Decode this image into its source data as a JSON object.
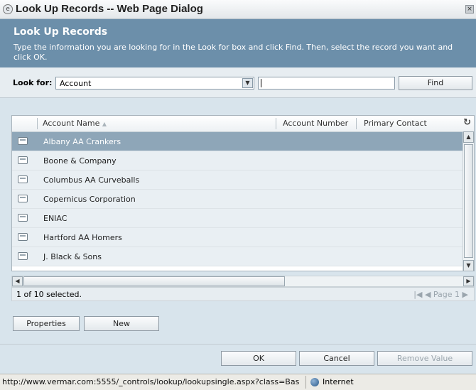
{
  "window": {
    "title": "Look Up Records -- Web Page Dialog",
    "icon": "ie-page-icon",
    "close_glyph": "×"
  },
  "header": {
    "title": "Look Up Records",
    "description": "Type the information you are looking for in the Look for box and click Find. Then, select the record you want and click OK."
  },
  "search": {
    "label": "Look for:",
    "entity": "Account",
    "dropdown_glyph": "▼",
    "value": "",
    "find_label": "Find"
  },
  "grid": {
    "columns": [
      {
        "label": "Account Name",
        "sort": "▲"
      },
      {
        "label": "Account Number"
      },
      {
        "label": "Primary Contact"
      }
    ],
    "refresh_glyph": "↻",
    "rows": [
      {
        "name": "Albany AA Crankers",
        "selected": true
      },
      {
        "name": "Boone & Company",
        "selected": false
      },
      {
        "name": "Columbus AA Curveballs",
        "selected": false
      },
      {
        "name": "Copernicus Corporation",
        "selected": false
      },
      {
        "name": "ENIAC",
        "selected": false
      },
      {
        "name": "Hartford AA Homers",
        "selected": false
      },
      {
        "name": "J. Black & Sons",
        "selected": false
      }
    ],
    "scroll_up": "▲",
    "scroll_down": "▼",
    "scroll_left": "◀",
    "scroll_right": "▶"
  },
  "status": {
    "selection": "1 of 10 selected.",
    "pager": "|◀ ◀ Page 1 ▶"
  },
  "actions": {
    "properties": "Properties",
    "new": "New",
    "ok": "OK",
    "cancel": "Cancel",
    "remove": "Remove Value"
  },
  "browser_status": {
    "url": "http://www.vermar.com:5555/_controls/lookup/lookupsingle.aspx?class=Bas",
    "zone": "Internet"
  },
  "colors": {
    "header_bg": "#6c8faa",
    "selected_row": "#8ea6b8",
    "row_bg": "#e9eff3"
  }
}
